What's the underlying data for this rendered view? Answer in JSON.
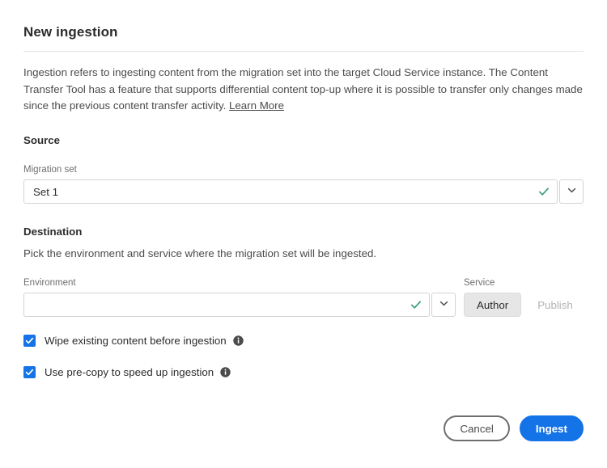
{
  "dialog": {
    "title": "New ingestion",
    "intro_text": "Ingestion refers to ingesting content from the migration set into the target Cloud Service instance. The Content Transfer Tool has a feature that supports differential content top-up where it is possible to transfer only changes made since the previous content transfer activity. ",
    "learn_more_label": "Learn More"
  },
  "source": {
    "heading": "Source",
    "migration_set": {
      "label": "Migration set",
      "value": "Set 1",
      "placeholder": "",
      "valid_icon": "checkmark-icon",
      "chevron_icon": "chevron-down-icon"
    }
  },
  "destination": {
    "heading": "Destination",
    "subtitle": "Pick the environment and service where the migration set will be ingested.",
    "environment": {
      "label": "Environment",
      "value": "",
      "placeholder": "",
      "valid_icon": "checkmark-icon",
      "chevron_icon": "chevron-down-icon"
    },
    "service": {
      "label": "Service",
      "options": [
        {
          "label": "Author",
          "selected": true,
          "disabled": false
        },
        {
          "label": "Publish",
          "selected": false,
          "disabled": true
        }
      ]
    }
  },
  "options": {
    "checkboxes": [
      {
        "label": "Wipe existing content before ingestion",
        "checked": true,
        "info_icon": "info-icon"
      },
      {
        "label": "Use pre-copy to speed up ingestion",
        "checked": true,
        "info_icon": "info-icon"
      }
    ]
  },
  "footer": {
    "cancel_label": "Cancel",
    "ingest_label": "Ingest"
  },
  "colors": {
    "accent_blue": "#1473E6",
    "valid_green": "#2D9D78",
    "text_primary": "#2C2C2C",
    "text_secondary": "#6E6E6E",
    "border": "#D3D3D3",
    "selected_button_bg": "#E6E6E6"
  }
}
